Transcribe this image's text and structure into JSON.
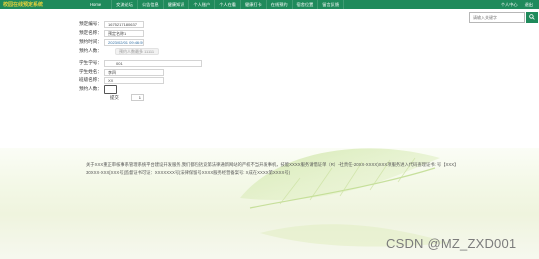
{
  "header": {
    "brand": "校园在线预定系统",
    "nav": [
      "Home",
      "交流论坛",
      "公告信息",
      "健康知识",
      "个人账户",
      "个人在看",
      "健康打卡",
      "在线预约",
      "宿舍位置",
      "留言反馈"
    ],
    "user_links": [
      "个人中心",
      "退出"
    ]
  },
  "search": {
    "placeholder": "请输入关键字",
    "icon": "search-icon"
  },
  "form": {
    "booking_no_label": "预定编号：",
    "booking_no_value": "1675217180637",
    "booking_name_label": "预定名称：",
    "booking_name_value": "预定名称1",
    "booking_time_label": "预约时间：",
    "booking_time_value": "2023/02/01 09:46:59",
    "count_label": "预约人数：",
    "count_value": "预约人数最多 11111",
    "student_no_label": "学生学号：",
    "student_no_value": "001",
    "student_name_label": "学生姓名：",
    "student_name_value": "李四",
    "class_label": "班级名称：",
    "class_value": "XX",
    "reserve_count_label": "预约人数：",
    "reserve_count_value": "",
    "submit_label": "提交",
    "submit_value": "1"
  },
  "footer": {
    "text": "关于XXX重正审核事系管理系统平台建设开发服务,我们都包括竞第法律通新网站的严权不当开发事机，技能XXXX服务请借证单（R）-社责任-20XX-XXXX)XXX项服务进入代码查理证书: 号【XXX】30XXX-XXX[XXX号]监督证书可证：XXXXXXX号|法律保留号XXXX服务经营备案号: X成在XXXX第XXXX号)",
    "watermark": "CSDN @MZ_ZXD001"
  }
}
